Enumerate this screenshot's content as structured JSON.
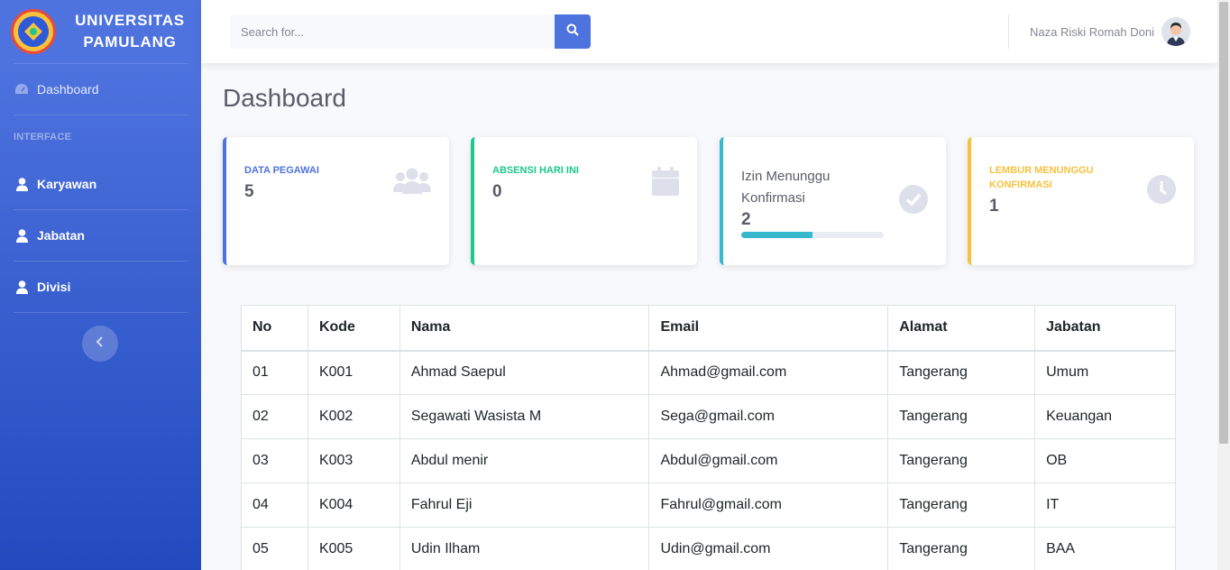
{
  "brand": {
    "line1": "UNIVERSITAS",
    "line2": "PAMULANG"
  },
  "sidebar": {
    "dashboard": "Dashboard",
    "heading": "INTERFACE",
    "items": [
      {
        "label": "Karyawan",
        "icon": "user-icon"
      },
      {
        "label": "Jabatan",
        "icon": "user-icon"
      },
      {
        "label": "Divisi",
        "icon": "user-icon"
      }
    ]
  },
  "topbar": {
    "search_placeholder": "Search for...",
    "user_name": "Naza Riski Romah Doni"
  },
  "page": {
    "title": "Dashboard"
  },
  "cards": [
    {
      "label": "DATA PEGAWAI",
      "value": "5",
      "color": "#4e73df",
      "icon": "users-icon"
    },
    {
      "label": "ABSENSI HARI INI",
      "value": "0",
      "color": "#1cc88a",
      "icon": "calendar-icon"
    },
    {
      "label": "Izin Menunggu Konfirmasi",
      "value": "2",
      "color": "#36b9cc",
      "icon": "check-circle-icon",
      "progress": 0.5
    },
    {
      "label": "LEMBUR MENUNGGU KONFIRMASI",
      "value": "1",
      "color": "#f6c23e",
      "icon": "clock-icon"
    }
  ],
  "table": {
    "headers": [
      "No",
      "Kode",
      "Nama",
      "Email",
      "Alamat",
      "Jabatan"
    ],
    "rows": [
      [
        "01",
        "K001",
        "Ahmad Saepul",
        "Ahmad@gmail.com",
        "Tangerang",
        "Umum"
      ],
      [
        "02",
        "K002",
        "Segawati Wasista M",
        "Sega@gmail.com",
        "Tangerang",
        "Keuangan"
      ],
      [
        "03",
        "K003",
        "Abdul menir",
        "Abdul@gmail.com",
        "Tangerang",
        "OB"
      ],
      [
        "04",
        "K004",
        "Fahrul Eji",
        "Fahrul@gmail.com",
        "Tangerang",
        "IT"
      ],
      [
        "05",
        "K005",
        "Udin Ilham",
        "Udin@gmail.com",
        "Tangerang",
        "BAA"
      ]
    ]
  }
}
